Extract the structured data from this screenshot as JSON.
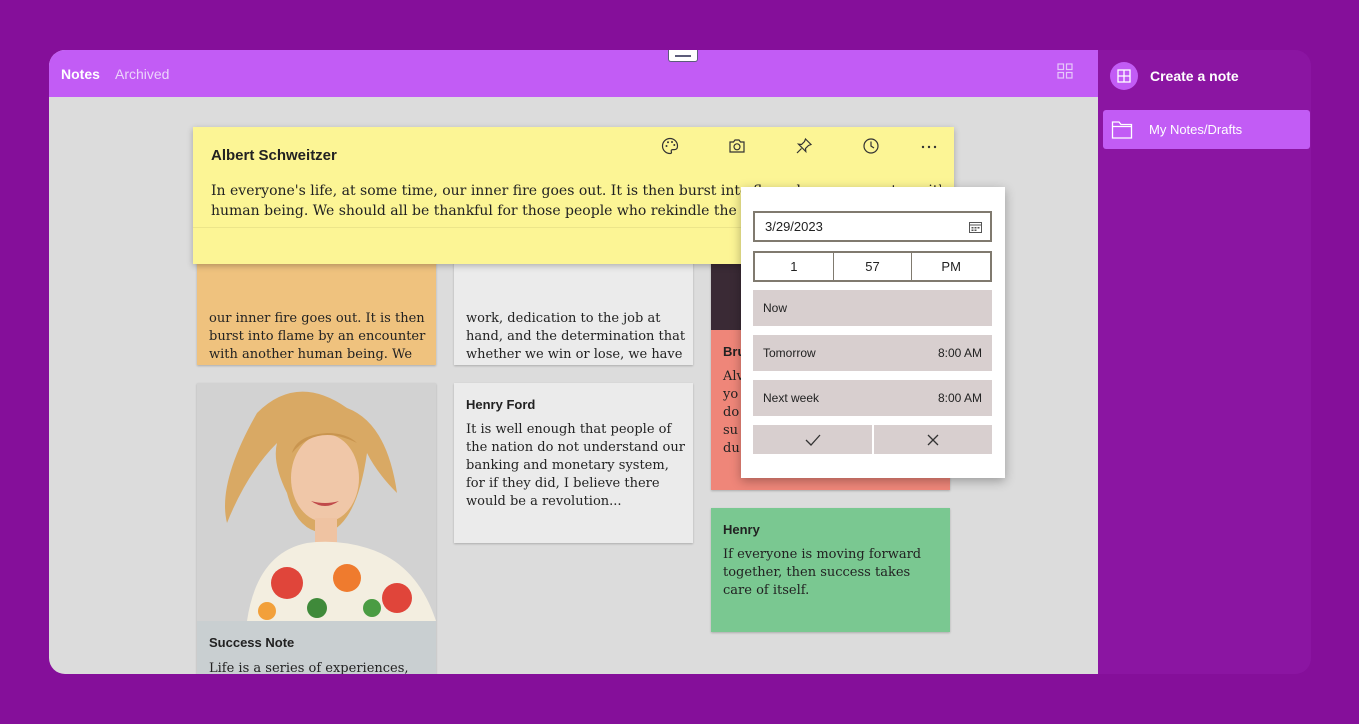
{
  "tabs": {
    "notes": "Notes",
    "archived": "Archived"
  },
  "sidebar": {
    "create_label": "Create a note",
    "folder_label": "My Notes/Drafts"
  },
  "active_note": {
    "title": "Albert Schweitzer",
    "body_line1": "In everyone's life, at some time, our inner fire goes out. It is then burst into flame by an encounter with another",
    "body_line2": "human being. We should all be thankful for those people who rekindle the inner spirit."
  },
  "notes": {
    "orange": {
      "body": "our inner fire goes out. It is then burst into flame by an encounter with another human being. We should all be thankful for those..."
    },
    "gray1": {
      "body": "work, dedication to the job at hand, and the determination that whether we win or lose, we have applied the best of..."
    },
    "photo": {
      "title": "Success Note",
      "body": "Life is a series of experiences,"
    },
    "henry_ford": {
      "title": "Henry Ford",
      "body": "It is well enough that people of the nation do not understand our banking and monetary system, for if they did, I believe there would be a revolution..."
    },
    "red": {
      "title": "Bru",
      "lines": [
        "Alv",
        "yo",
        "do",
        "su",
        "du"
      ]
    },
    "henry": {
      "title": "Henry",
      "body": "If everyone is moving forward together, then success takes care of itself."
    }
  },
  "reminder": {
    "date": "3/29/2023",
    "hour": "1",
    "minute": "57",
    "ampm": "PM",
    "options": [
      {
        "label": "Now",
        "time": ""
      },
      {
        "label": "Tomorrow",
        "time": "8:00 AM"
      },
      {
        "label": "Next week",
        "time": "8:00 AM"
      }
    ]
  },
  "icons": [
    "grid-icon",
    "palette-icon",
    "camera-icon",
    "pin-icon",
    "clock-icon",
    "more-icon",
    "calendar-icon",
    "check-icon",
    "close-icon",
    "plus-square-icon",
    "folder-icon"
  ],
  "colors": {
    "accent": "#c25cf5",
    "sidebar": "#8b15a2",
    "note_yellow": "#fcf595",
    "note_orange": "#efc27e",
    "note_red": "#ef8679",
    "note_green": "#7ac891"
  }
}
